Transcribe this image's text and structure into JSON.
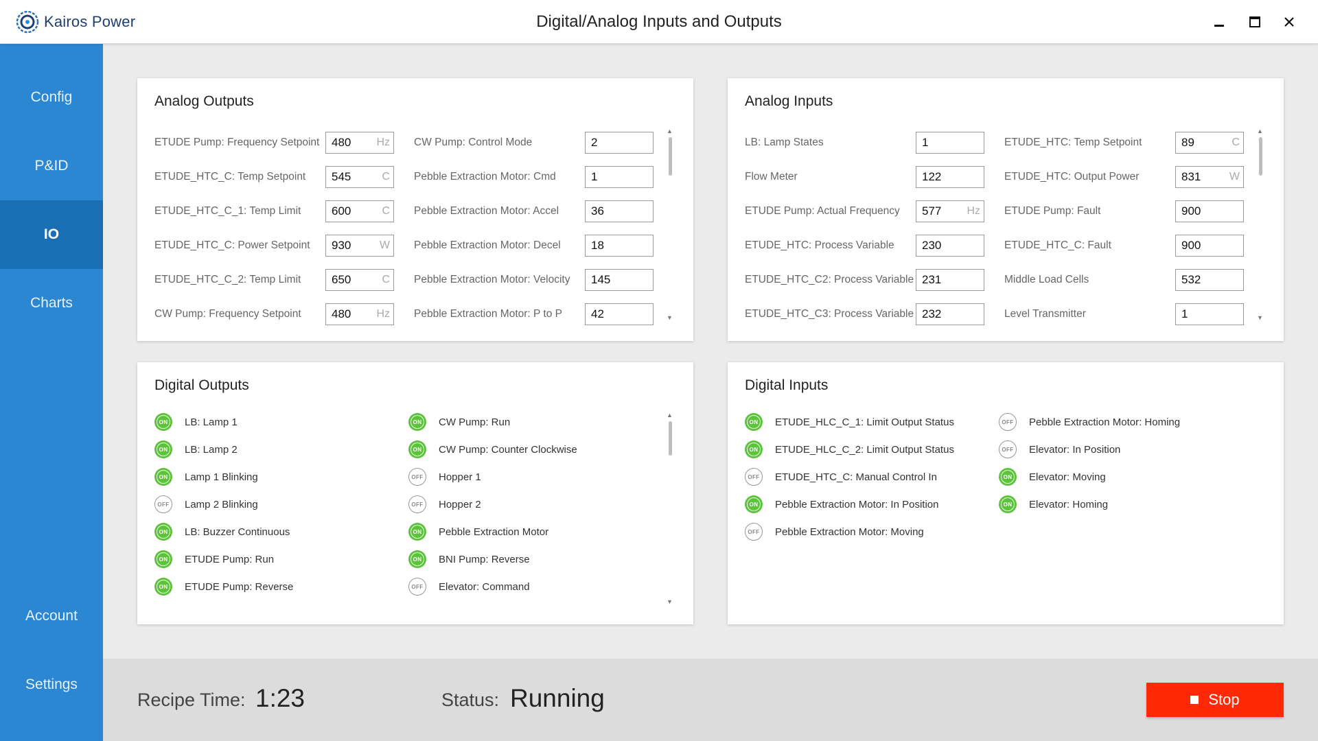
{
  "app": {
    "logo_text": "Kairos Power",
    "window_title": "Digital/Analog Inputs and Outputs"
  },
  "sidebar": {
    "items": [
      {
        "label": "Config",
        "active": false
      },
      {
        "label": "P&ID",
        "active": false
      },
      {
        "label": "IO",
        "active": true
      },
      {
        "label": "Charts",
        "active": false
      },
      {
        "label": "Account",
        "active": false
      },
      {
        "label": "Settings",
        "active": false
      }
    ]
  },
  "analog_outputs": {
    "title": "Analog Outputs",
    "rows": [
      {
        "label": "ETUDE Pump: Frequency Setpoint",
        "value": "480",
        "unit": "Hz"
      },
      {
        "label": "ETUDE_HTC_C: Temp Setpoint",
        "value": "545",
        "unit": "C"
      },
      {
        "label": "ETUDE_HTC_C_1: Temp Limit",
        "value": "600",
        "unit": "C"
      },
      {
        "label": "ETUDE_HTC_C: Power Setpoint",
        "value": "930",
        "unit": "W"
      },
      {
        "label": "ETUDE_HTC_C_2: Temp Limit",
        "value": "650",
        "unit": "C"
      },
      {
        "label": "CW Pump: Frequency Setpoint",
        "value": "480",
        "unit": "Hz"
      },
      {
        "label": "CW Pump: Control Mode",
        "value": "2",
        "unit": ""
      },
      {
        "label": "Pebble Extraction Motor: Cmd",
        "value": "1",
        "unit": ""
      },
      {
        "label": "Pebble Extraction Motor: Accel",
        "value": "36",
        "unit": ""
      },
      {
        "label": "Pebble Extraction Motor: Decel",
        "value": "18",
        "unit": ""
      },
      {
        "label": "Pebble Extraction Motor: Velocity",
        "value": "145",
        "unit": ""
      },
      {
        "label": "Pebble Extraction Motor: P to P",
        "value": "42",
        "unit": ""
      }
    ]
  },
  "analog_inputs": {
    "title": "Analog Inputs",
    "rows": [
      {
        "label": "LB: Lamp States",
        "value": "1",
        "unit": ""
      },
      {
        "label": "Flow Meter",
        "value": "122",
        "unit": ""
      },
      {
        "label": "ETUDE Pump: Actual Frequency",
        "value": "577",
        "unit": "Hz"
      },
      {
        "label": "ETUDE_HTC: Process Variable",
        "value": "230",
        "unit": ""
      },
      {
        "label": "ETUDE_HTC_C2: Process Variable",
        "value": "231",
        "unit": ""
      },
      {
        "label": "ETUDE_HTC_C3: Process Variable",
        "value": "232",
        "unit": ""
      },
      {
        "label": "ETUDE_HTC: Temp Setpoint",
        "value": "89",
        "unit": "C"
      },
      {
        "label": "ETUDE_HTC: Output Power",
        "value": "831",
        "unit": "W"
      },
      {
        "label": "ETUDE Pump: Fault",
        "value": "900",
        "unit": ""
      },
      {
        "label": "ETUDE_HTC_C: Fault",
        "value": "900",
        "unit": ""
      },
      {
        "label": "Middle Load Cells",
        "value": "532",
        "unit": ""
      },
      {
        "label": "Level Transmitter",
        "value": "1",
        "unit": ""
      }
    ]
  },
  "digital_outputs": {
    "title": "Digital Outputs",
    "items": [
      {
        "label": "LB: Lamp 1",
        "state": "ON"
      },
      {
        "label": "LB: Lamp 2",
        "state": "ON"
      },
      {
        "label": "Lamp 1 Blinking",
        "state": "ON"
      },
      {
        "label": "Lamp 2 Blinking",
        "state": "OFF"
      },
      {
        "label": "LB: Buzzer Continuous",
        "state": "ON"
      },
      {
        "label": "ETUDE Pump: Run",
        "state": "ON"
      },
      {
        "label": "ETUDE Pump: Reverse",
        "state": "ON"
      },
      {
        "label": "CW Pump: Run",
        "state": "ON"
      },
      {
        "label": "CW Pump: Counter Clockwise",
        "state": "ON"
      },
      {
        "label": "Hopper 1",
        "state": "OFF"
      },
      {
        "label": "Hopper 2",
        "state": "OFF"
      },
      {
        "label": "Pebble Extraction Motor",
        "state": "ON"
      },
      {
        "label": "BNI Pump: Reverse",
        "state": "ON"
      },
      {
        "label": "Elevator: Command",
        "state": "OFF"
      }
    ]
  },
  "digital_inputs": {
    "title": "Digital Inputs",
    "items": [
      {
        "label": "ETUDE_HLC_C_1: Limit Output Status",
        "state": "ON"
      },
      {
        "label": "ETUDE_HLC_C_2: Limit Output Status",
        "state": "ON"
      },
      {
        "label": "ETUDE_HTC_C: Manual Control In",
        "state": "OFF"
      },
      {
        "label": "Pebble Extraction Motor: In Position",
        "state": "ON"
      },
      {
        "label": "Pebble Extraction Motor: Moving",
        "state": "OFF"
      },
      {
        "label": "Pebble Extraction Motor: Homing",
        "state": "OFF"
      },
      {
        "label": "Elevator: In Position",
        "state": "OFF"
      },
      {
        "label": "Elevator: Moving",
        "state": "ON"
      },
      {
        "label": "Elevator: Homing",
        "state": "ON"
      }
    ]
  },
  "footer": {
    "recipe_time_label": "Recipe Time:",
    "recipe_time_value": "1:23",
    "status_label": "Status:",
    "status_value": "Running",
    "stop_label": "Stop"
  },
  "colors": {
    "sidebar": "#2b87d1",
    "sidebar_active": "#1a6fb4",
    "on_badge": "#5cc43a",
    "stop_button": "#ff2a05"
  }
}
